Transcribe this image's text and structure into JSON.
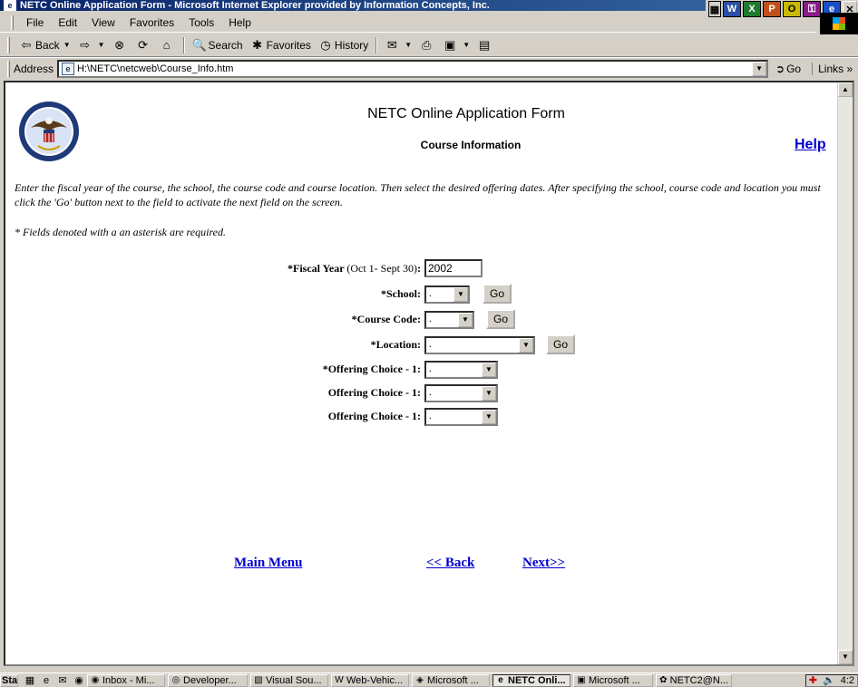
{
  "window": {
    "title": "NETC Online Application Form - Microsoft Internet Explorer provided by Information Concepts, Inc."
  },
  "menu": [
    "File",
    "Edit",
    "View",
    "Favorites",
    "Tools",
    "Help"
  ],
  "toolbar": {
    "back": "Back",
    "search": "Search",
    "favorites": "Favorites",
    "history": "History"
  },
  "address": {
    "label": "Address",
    "url": "H:\\NETC\\netcweb\\Course_Info.htm",
    "go": "Go",
    "links": "Links"
  },
  "page": {
    "title": "NETC Online Application Form",
    "subtitle": "Course Information",
    "help": "Help",
    "instructions": "Enter the fiscal year of the course, the school, the course code and course location. Then select the desired offering dates. After specifying the school, course code and location you must click the 'Go' button next to the field to activate the next field on the screen.",
    "required_note": "* Fields denoted with a an asterisk are required.",
    "fields": {
      "fiscal_year_label": "*Fiscal Year",
      "fiscal_year_hint": "(Oct 1- Sept 30)",
      "fiscal_year_colon": ":",
      "fiscal_year_value": "2002",
      "school_label": "*School:",
      "school_value": ".",
      "course_code_label": "*Course Code:",
      "course_code_value": ".",
      "location_label": "*Location:",
      "location_value": ".",
      "offering_1_label": "*Offering Choice - 1:",
      "offering_1_value": ".",
      "offering_2_label": "Offering Choice - 1:",
      "offering_2_value": ".",
      "offering_3_label": "Offering Choice - 1:",
      "offering_3_value": ".",
      "go_label": "Go"
    },
    "nav": {
      "main_menu": "Main Menu",
      "back": "<< Back",
      "next": "Next>>"
    }
  },
  "taskbar": {
    "start": "Start",
    "tasks": [
      "Inbox - Mi...",
      "Developer...",
      "Visual Sou...",
      "Web-Vehic...",
      "Microsoft ...",
      "NETC Onli...",
      "Microsoft ...",
      "NETC2@N..."
    ],
    "active_task": "NETC Onli...",
    "clock": "4:2"
  }
}
